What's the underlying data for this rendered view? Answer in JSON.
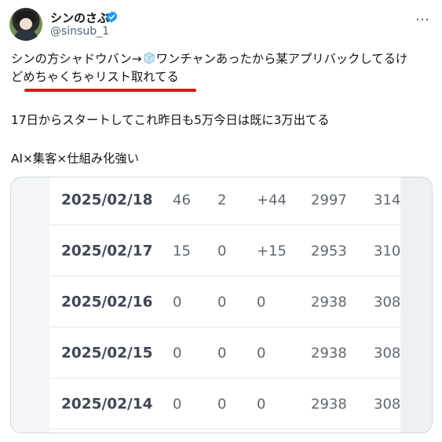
{
  "user": {
    "name": "シンのさぶ",
    "handle": "@sinsub_1",
    "more_label": "…"
  },
  "tweet": {
    "line1_before": "シンの方シャドウバン→",
    "line1_after": "ワンチャンあったから某アプリバックしてるけ",
    "line2": "どめちゃくちゃリスト取れてる",
    "para2": "17日からスタートしてこれ昨日も5万今日は既に3万出てる",
    "para3": "AI×集客×仕組み化強い"
  },
  "table": {
    "rows": [
      {
        "date": "2025/02/18",
        "c1": "46",
        "c2": "2",
        "c3": "+44",
        "c4": "2997",
        "c5": "314"
      },
      {
        "date": "2025/02/17",
        "c1": "15",
        "c2": "0",
        "c3": "+15",
        "c4": "2953",
        "c5": "310"
      },
      {
        "date": "2025/02/16",
        "c1": "0",
        "c2": "0",
        "c3": "0",
        "c4": "2938",
        "c5": "308"
      },
      {
        "date": "2025/02/15",
        "c1": "0",
        "c2": "0",
        "c3": "0",
        "c4": "2938",
        "c5": "308"
      },
      {
        "date": "2025/02/14",
        "c1": "0",
        "c2": "0",
        "c3": "0",
        "c4": "2938",
        "c5": "308"
      }
    ]
  },
  "colors": {
    "verified": "#1d9bf0",
    "underline": "#e3121b"
  }
}
